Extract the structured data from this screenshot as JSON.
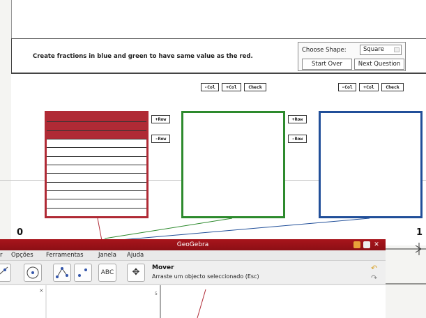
{
  "top_cut": {
    "left": "",
    "right": ""
  },
  "applet": {
    "instructions": "Create fractions in blue and green to have same value as the red.",
    "choose_shape_label": "Choose Shape:",
    "shape_value": "Square",
    "start_over": "Start Over",
    "next_question": "Next Question",
    "green_controls": {
      "minus_col": "-Col",
      "plus_col": "+Col",
      "check": "Check",
      "plus_row": "+Row",
      "minus_row": "-Row"
    },
    "blue_controls": {
      "minus_col": "-Col",
      "plus_col": "+Col",
      "check": "Check",
      "plus_row": "+Row",
      "minus_row": "-Row"
    },
    "red_controls": {
      "plus_row": "+Row",
      "minus_row": "-Row"
    },
    "axis_start": "0",
    "axis_end": "1",
    "red_fraction": {
      "shaded_rows": 3,
      "total_rows": 12
    },
    "colors": {
      "red": "#b02a35",
      "green": "#2d8a2d",
      "blue": "#214f99"
    }
  },
  "geogebra": {
    "title": "GeoGebra",
    "menus": [
      "r",
      "Opções",
      "Ferramentas",
      "Janela",
      "Ajuda"
    ],
    "tools": [
      "line-tool",
      "circle-tool",
      "point-tool",
      "point-tool-2",
      "text-tool-ABC",
      "move-tool"
    ],
    "text_tool_label": "ABC",
    "tool_name": "Mover",
    "tool_description": "Arraste um objecto seleccionado (Esc)"
  }
}
